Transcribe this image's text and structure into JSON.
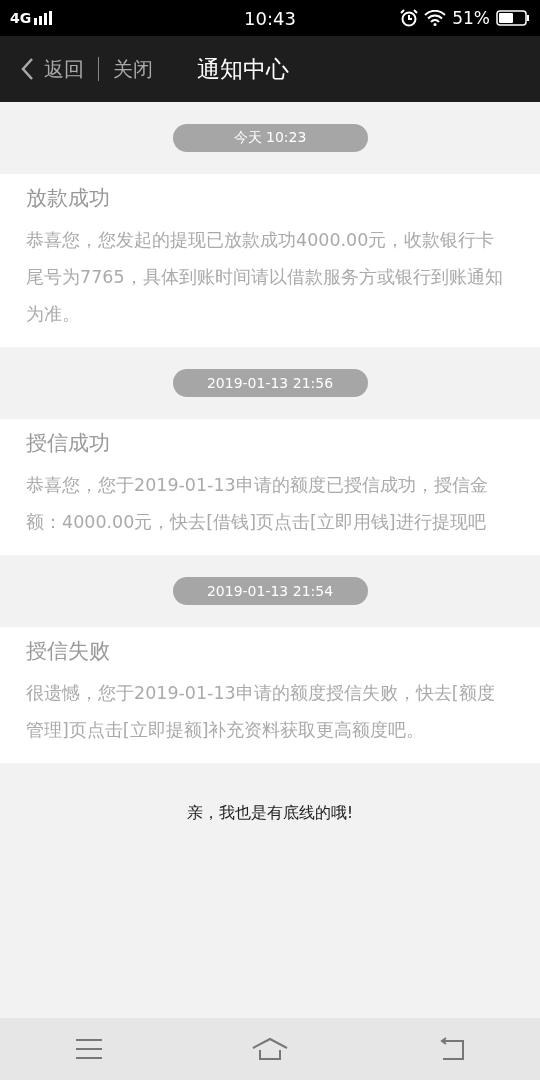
{
  "status_bar": {
    "network": "4G",
    "time": "10:43",
    "battery": "51%"
  },
  "header": {
    "back": "返回",
    "close": "关闭",
    "title": "通知中心"
  },
  "notifications": [
    {
      "time": "今天 10:23",
      "title": "放款成功",
      "body": "恭喜您，您发起的提现已放款成功4000.00元，收款银行卡尾号为7765，具体到账时间请以借款服务方或银行到账通知为准。"
    },
    {
      "time": "2019-01-13 21:56",
      "title": "授信成功",
      "body": "恭喜您，您于2019-01-13申请的额度已授信成功，授信金额：4000.00元，快去[借钱]页点击[立即用钱]进行提现吧"
    },
    {
      "time": "2019-01-13 21:54",
      "title": "授信失败",
      "body": "很遗憾，您于2019-01-13申请的额度授信失败，快去[额度管理]页点击[立即提额]补充资料获取更高额度吧。"
    }
  ],
  "footer_note": "亲，我也是有底线的哦!"
}
